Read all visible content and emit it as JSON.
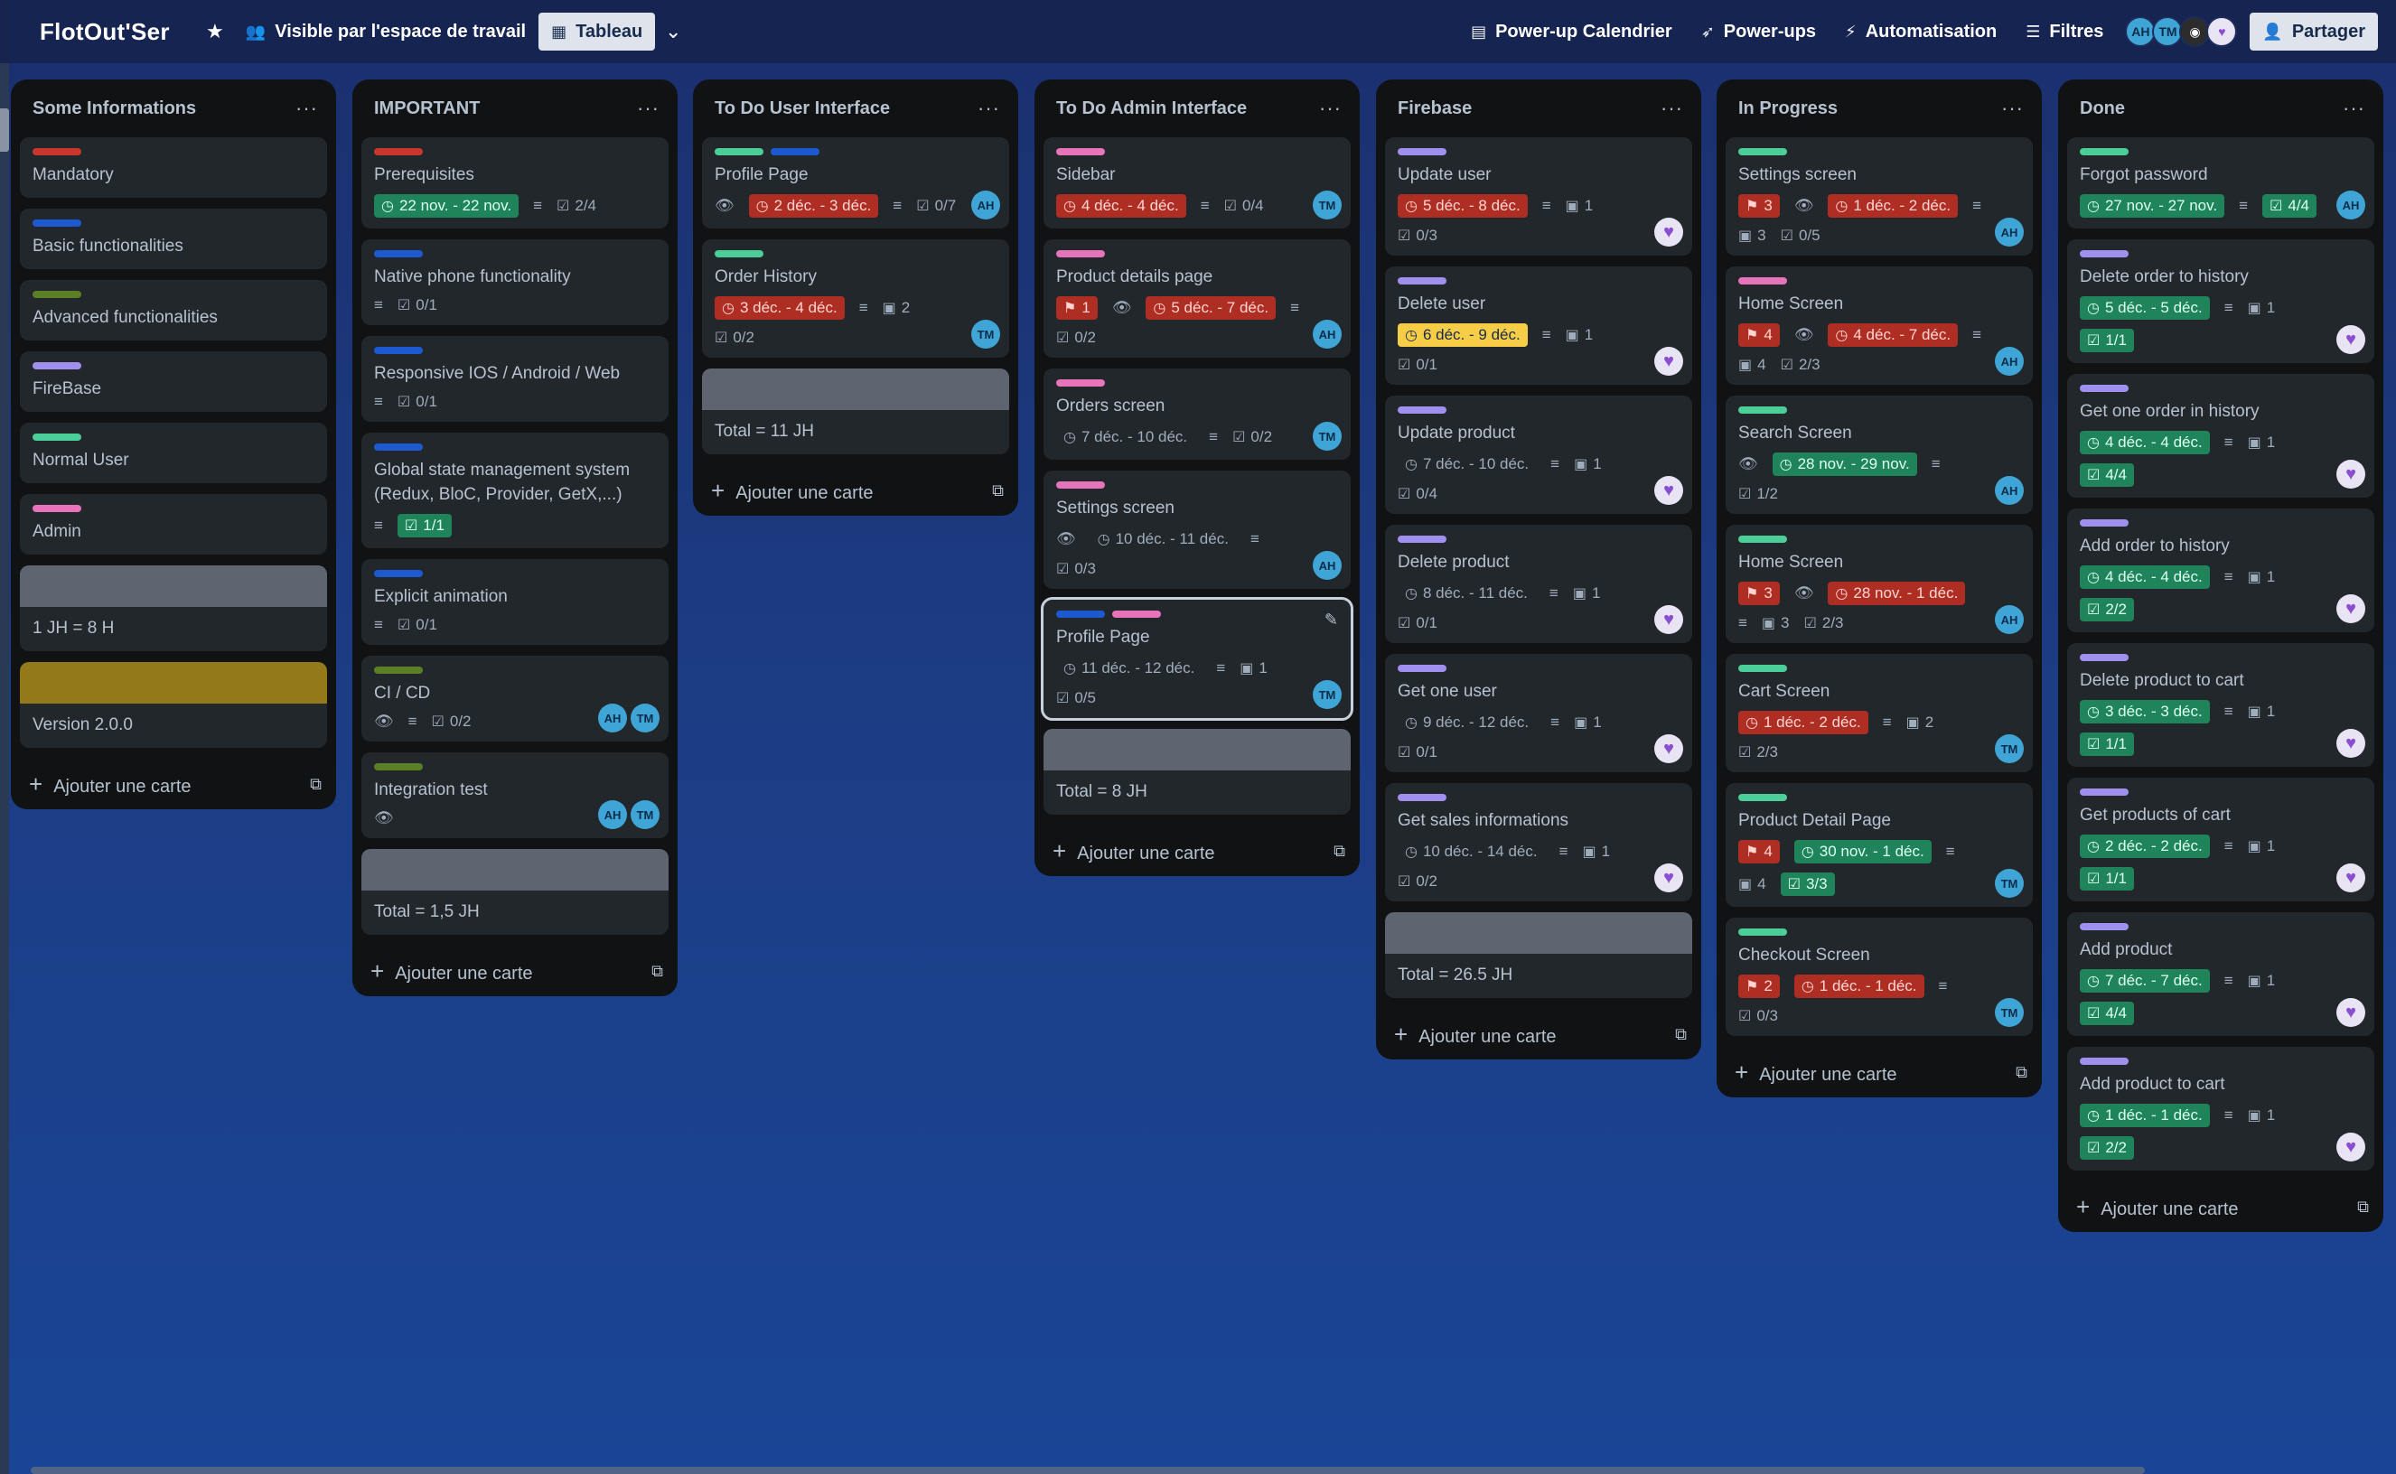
{
  "header": {
    "board_title": "FlotOut'Ser",
    "visibility": "Visible par l'espace de travail",
    "view": "Tableau",
    "calendar": "Power-up Calendrier",
    "powerups": "Power-ups",
    "automation": "Automatisation",
    "filters": "Filtres",
    "share": "Partager",
    "members": [
      "AH",
      "TM"
    ]
  },
  "add_card_label": "Ajouter une carte",
  "lists": [
    {
      "title": "Some Informations",
      "cards": [
        {
          "labels": [
            "red"
          ],
          "title": "Mandatory"
        },
        {
          "labels": [
            "blue"
          ],
          "title": "Basic functionalities"
        },
        {
          "labels": [
            "olive"
          ],
          "title": "Advanced functionalities"
        },
        {
          "labels": [
            "purple"
          ],
          "title": "FireBase"
        },
        {
          "labels": [
            "green"
          ],
          "title": "Normal User"
        },
        {
          "labels": [
            "pink"
          ],
          "title": "Admin"
        },
        {
          "cover": "grey",
          "title": "1 JH = 8 H"
        },
        {
          "cover": "yellow",
          "title": "Version 2.0.0"
        }
      ]
    },
    {
      "title": "IMPORTANT",
      "cards": [
        {
          "labels": [
            "red"
          ],
          "title": "Prerequisites",
          "date": {
            "text": "22 nov. - 22 nov.",
            "color": "green"
          },
          "desc": true,
          "checklist": {
            "text": "2/4"
          }
        },
        {
          "labels": [
            "blue"
          ],
          "title": "Native phone functionality",
          "desc": true,
          "checklist": {
            "text": "0/1"
          }
        },
        {
          "labels": [
            "blue"
          ],
          "title": "Responsive IOS / Android / Web",
          "desc": true,
          "checklist": {
            "text": "0/1"
          }
        },
        {
          "labels": [
            "blue"
          ],
          "title": "Global state management system (Redux, BloC, Provider, GetX,...)",
          "desc": true,
          "checklist": {
            "text": "1/1",
            "color": "green"
          }
        },
        {
          "labels": [
            "blue"
          ],
          "title": "Explicit animation",
          "desc": true,
          "checklist": {
            "text": "0/1"
          }
        },
        {
          "labels": [
            "olive"
          ],
          "title": "CI / CD",
          "watch": true,
          "desc": true,
          "checklist": {
            "text": "0/2"
          },
          "members": [
            "AH",
            "TM"
          ]
        },
        {
          "labels": [
            "olive"
          ],
          "title": "Integration test",
          "watch": true,
          "members": [
            "AH",
            "TM"
          ]
        },
        {
          "cover": "grey",
          "title": "Total = 1,5 JH"
        }
      ]
    },
    {
      "title": "To Do User Interface",
      "cards": [
        {
          "labels": [
            "green",
            "blue"
          ],
          "title": "Profile Page",
          "watch": true,
          "date": {
            "text": "2 déc. - 3 déc.",
            "color": "red"
          },
          "desc": true,
          "checklist": {
            "text": "0/7"
          },
          "members": [
            "AH"
          ]
        },
        {
          "labels": [
            "green"
          ],
          "title": "Order History",
          "date": {
            "text": "3 déc. - 4 déc.",
            "color": "red"
          },
          "desc": true,
          "attach": "2",
          "checklist": {
            "text": "0/2"
          },
          "members": [
            "TM"
          ]
        },
        {
          "cover": "grey",
          "title": "Total = 11 JH"
        }
      ]
    },
    {
      "title": "To Do Admin Interface",
      "cards": [
        {
          "labels": [
            "pink"
          ],
          "title": "Sidebar",
          "date": {
            "text": "4 déc. - 4 déc.",
            "color": "red"
          },
          "desc": true,
          "checklist": {
            "text": "0/4"
          },
          "members": [
            "TM"
          ]
        },
        {
          "labels": [
            "pink"
          ],
          "title": "Product details page",
          "votes": {
            "text": "1",
            "color": "red"
          },
          "watch": true,
          "date": {
            "text": "5 déc. - 7 déc.",
            "color": "red"
          },
          "desc": true,
          "checklist": {
            "text": "0/2"
          },
          "members": [
            "AH"
          ]
        },
        {
          "labels": [
            "pink"
          ],
          "title": "Orders screen",
          "date": {
            "text": "7 déc. - 10 déc."
          },
          "desc": true,
          "checklist": {
            "text": "0/2"
          },
          "members": [
            "TM"
          ]
        },
        {
          "labels": [
            "pink"
          ],
          "title": "Settings screen",
          "watch": true,
          "date": {
            "text": "10 déc. - 11 déc."
          },
          "desc": true,
          "checklist": {
            "text": "0/3"
          },
          "members": [
            "AH"
          ]
        },
        {
          "labels": [
            "blue",
            "pink"
          ],
          "title": "Profile Page",
          "selected": true,
          "date": {
            "text": "11 déc. - 12 déc."
          },
          "desc": true,
          "attach": "1",
          "checklist": {
            "text": "0/5"
          },
          "members": [
            "TM"
          ]
        },
        {
          "cover": "grey",
          "title": "Total = 8 JH"
        }
      ]
    },
    {
      "title": "Firebase",
      "cards": [
        {
          "labels": [
            "purple"
          ],
          "title": "Update user",
          "date": {
            "text": "5 déc. - 8 déc.",
            "color": "red"
          },
          "desc": true,
          "attach": "1",
          "checklist": {
            "text": "0/3"
          },
          "members": [
            "heart"
          ]
        },
        {
          "labels": [
            "purple"
          ],
          "title": "Delete user",
          "date": {
            "text": "6 déc. - 9 déc.",
            "color": "yellow"
          },
          "desc": true,
          "attach": "1",
          "checklist": {
            "text": "0/1"
          },
          "members": [
            "heart"
          ]
        },
        {
          "labels": [
            "purple"
          ],
          "title": "Update product",
          "date": {
            "text": "7 déc. - 10 déc."
          },
          "desc": true,
          "attach": "1",
          "checklist": {
            "text": "0/4"
          },
          "members": [
            "heart"
          ]
        },
        {
          "labels": [
            "purple"
          ],
          "title": "Delete product",
          "date": {
            "text": "8 déc. - 11 déc."
          },
          "desc": true,
          "attach": "1",
          "checklist": {
            "text": "0/1"
          },
          "members": [
            "heart"
          ]
        },
        {
          "labels": [
            "purple"
          ],
          "title": "Get one user",
          "date": {
            "text": "9 déc. - 12 déc."
          },
          "desc": true,
          "attach": "1",
          "checklist": {
            "text": "0/1"
          },
          "members": [
            "heart"
          ]
        },
        {
          "labels": [
            "purple"
          ],
          "title": "Get sales informations",
          "date": {
            "text": "10 déc. - 14 déc."
          },
          "desc": true,
          "attach": "1",
          "checklist": {
            "text": "0/2"
          },
          "members": [
            "heart"
          ]
        },
        {
          "cover": "grey",
          "title": "Total = 26.5 JH"
        }
      ]
    },
    {
      "title": "In Progress",
      "cards": [
        {
          "labels": [
            "green"
          ],
          "title": "Settings screen",
          "votes": {
            "text": "3",
            "color": "red"
          },
          "watch": true,
          "date": {
            "text": "1 déc. - 2 déc.",
            "color": "red"
          },
          "desc": true,
          "attach": "3",
          "checklist": {
            "text": "0/5"
          },
          "members": [
            "AH"
          ]
        },
        {
          "labels": [
            "pink"
          ],
          "title": "Home Screen",
          "votes": {
            "text": "4",
            "color": "red"
          },
          "watch": true,
          "date": {
            "text": "4 déc. - 7 déc.",
            "color": "red"
          },
          "desc": true,
          "attach": "4",
          "checklist": {
            "text": "2/3"
          },
          "members": [
            "AH"
          ]
        },
        {
          "labels": [
            "green"
          ],
          "title": "Search Screen",
          "watch": true,
          "date": {
            "text": "28 nov. - 29 nov.",
            "color": "green"
          },
          "desc": true,
          "checklist": {
            "text": "1/2"
          },
          "members": [
            "AH"
          ]
        },
        {
          "labels": [
            "green"
          ],
          "title": "Home Screen",
          "votes": {
            "text": "3",
            "color": "red"
          },
          "watch": true,
          "date": {
            "text": "28 nov. - 1 déc.",
            "color": "red"
          },
          "desc": true,
          "attach": "3",
          "checklist": {
            "text": "2/3"
          },
          "members": [
            "AH"
          ]
        },
        {
          "labels": [
            "green"
          ],
          "title": "Cart Screen",
          "date": {
            "text": "1 déc. - 2 déc.",
            "color": "red"
          },
          "desc": true,
          "attach": "2",
          "checklist": {
            "text": "2/3"
          },
          "members": [
            "TM"
          ]
        },
        {
          "labels": [
            "green"
          ],
          "title": "Product Detail Page",
          "votes": {
            "text": "4",
            "color": "red"
          },
          "date": {
            "text": "30 nov. - 1 déc.",
            "color": "green"
          },
          "desc": true,
          "attach": "4",
          "checklist": {
            "text": "3/3",
            "color": "green"
          },
          "members": [
            "TM"
          ]
        },
        {
          "labels": [
            "green"
          ],
          "title": "Checkout Screen",
          "votes": {
            "text": "2",
            "color": "red"
          },
          "date": {
            "text": "1 déc. - 1 déc.",
            "color": "red"
          },
          "desc": true,
          "checklist": {
            "text": "0/3"
          },
          "members": [
            "TM"
          ]
        }
      ]
    },
    {
      "title": "Done",
      "cards": [
        {
          "labels": [
            "green"
          ],
          "title": "Forgot password",
          "date": {
            "text": "27 nov. - 27 nov.",
            "color": "green"
          },
          "desc": true,
          "checklist": {
            "text": "4/4",
            "color": "green"
          },
          "members": [
            "AH"
          ]
        },
        {
          "labels": [
            "purple"
          ],
          "title": "Delete order to history",
          "date": {
            "text": "5 déc. - 5 déc.",
            "color": "green"
          },
          "desc": true,
          "attach": "1",
          "checklist": {
            "text": "1/1",
            "color": "green"
          },
          "members": [
            "heart"
          ]
        },
        {
          "labels": [
            "purple"
          ],
          "title": "Get one order in history",
          "date": {
            "text": "4 déc. - 4 déc.",
            "color": "green"
          },
          "desc": true,
          "attach": "1",
          "checklist": {
            "text": "4/4",
            "color": "green"
          },
          "members": [
            "heart"
          ]
        },
        {
          "labels": [
            "purple"
          ],
          "title": "Add order to history",
          "date": {
            "text": "4 déc. - 4 déc.",
            "color": "green"
          },
          "desc": true,
          "attach": "1",
          "checklist": {
            "text": "2/2",
            "color": "green"
          },
          "members": [
            "heart"
          ]
        },
        {
          "labels": [
            "purple"
          ],
          "title": "Delete product to cart",
          "date": {
            "text": "3 déc. - 3 déc.",
            "color": "green"
          },
          "desc": true,
          "attach": "1",
          "checklist": {
            "text": "1/1",
            "color": "green"
          },
          "members": [
            "heart"
          ]
        },
        {
          "labels": [
            "purple"
          ],
          "title": "Get products of cart",
          "date": {
            "text": "2 déc. - 2 déc.",
            "color": "green"
          },
          "desc": true,
          "attach": "1",
          "checklist": {
            "text": "1/1",
            "color": "green"
          },
          "members": [
            "heart"
          ]
        },
        {
          "labels": [
            "purple"
          ],
          "title": "Add product",
          "date": {
            "text": "7 déc. - 7 déc.",
            "color": "green"
          },
          "desc": true,
          "attach": "1",
          "checklist": {
            "text": "4/4",
            "color": "green"
          },
          "members": [
            "heart"
          ]
        },
        {
          "labels": [
            "purple"
          ],
          "title": "Add product to cart",
          "date": {
            "text": "1 déc. - 1 déc.",
            "color": "green"
          },
          "desc": true,
          "attach": "1",
          "checklist": {
            "text": "2/2",
            "color": "green"
          },
          "members": [
            "heart"
          ]
        }
      ]
    }
  ]
}
